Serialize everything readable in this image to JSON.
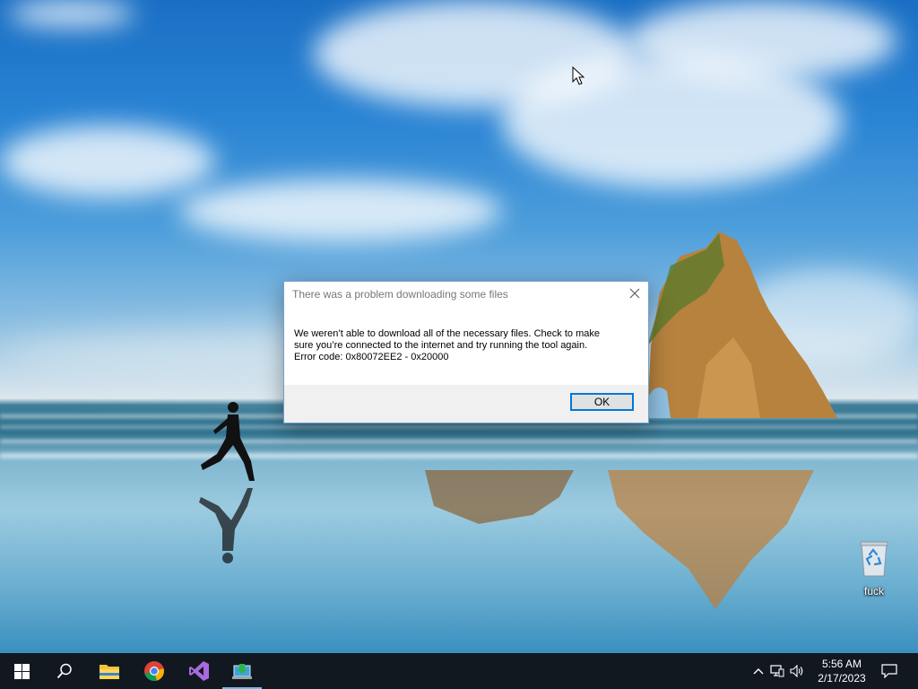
{
  "dialog": {
    "title": "There was a problem downloading some files",
    "message_lines": [
      "We weren’t able to download all of the necessary files. Check to make",
      "sure you’re connected to the internet and try running the tool again.",
      "Error code: 0x80072EE2 - 0x20000"
    ],
    "ok_label": "OK"
  },
  "desktop": {
    "icons": [
      {
        "label": "fuck",
        "icon": "recycle-bin-icon"
      }
    ]
  },
  "taskbar": {
    "start_icon": "windows-logo-icon",
    "search_icon": "search-icon",
    "apps": [
      {
        "name": "File Explorer",
        "icon": "folder-icon"
      },
      {
        "name": "Google Chrome",
        "icon": "chrome-icon"
      },
      {
        "name": "Visual Studio",
        "icon": "visual-studio-icon"
      },
      {
        "name": "Media Creation Tool",
        "icon": "media-creation-tool-icon",
        "active": true
      }
    ],
    "tray_icons": [
      "chevron-up-icon",
      "network-icon",
      "volume-icon"
    ],
    "clock": {
      "time": "5:56 AM",
      "date": "2/17/2023"
    },
    "notification_icon": "action-center-icon"
  },
  "colors": {
    "taskbar": "#121820",
    "accent": "#0078d7",
    "dialog_border": "#6f9fd0"
  }
}
